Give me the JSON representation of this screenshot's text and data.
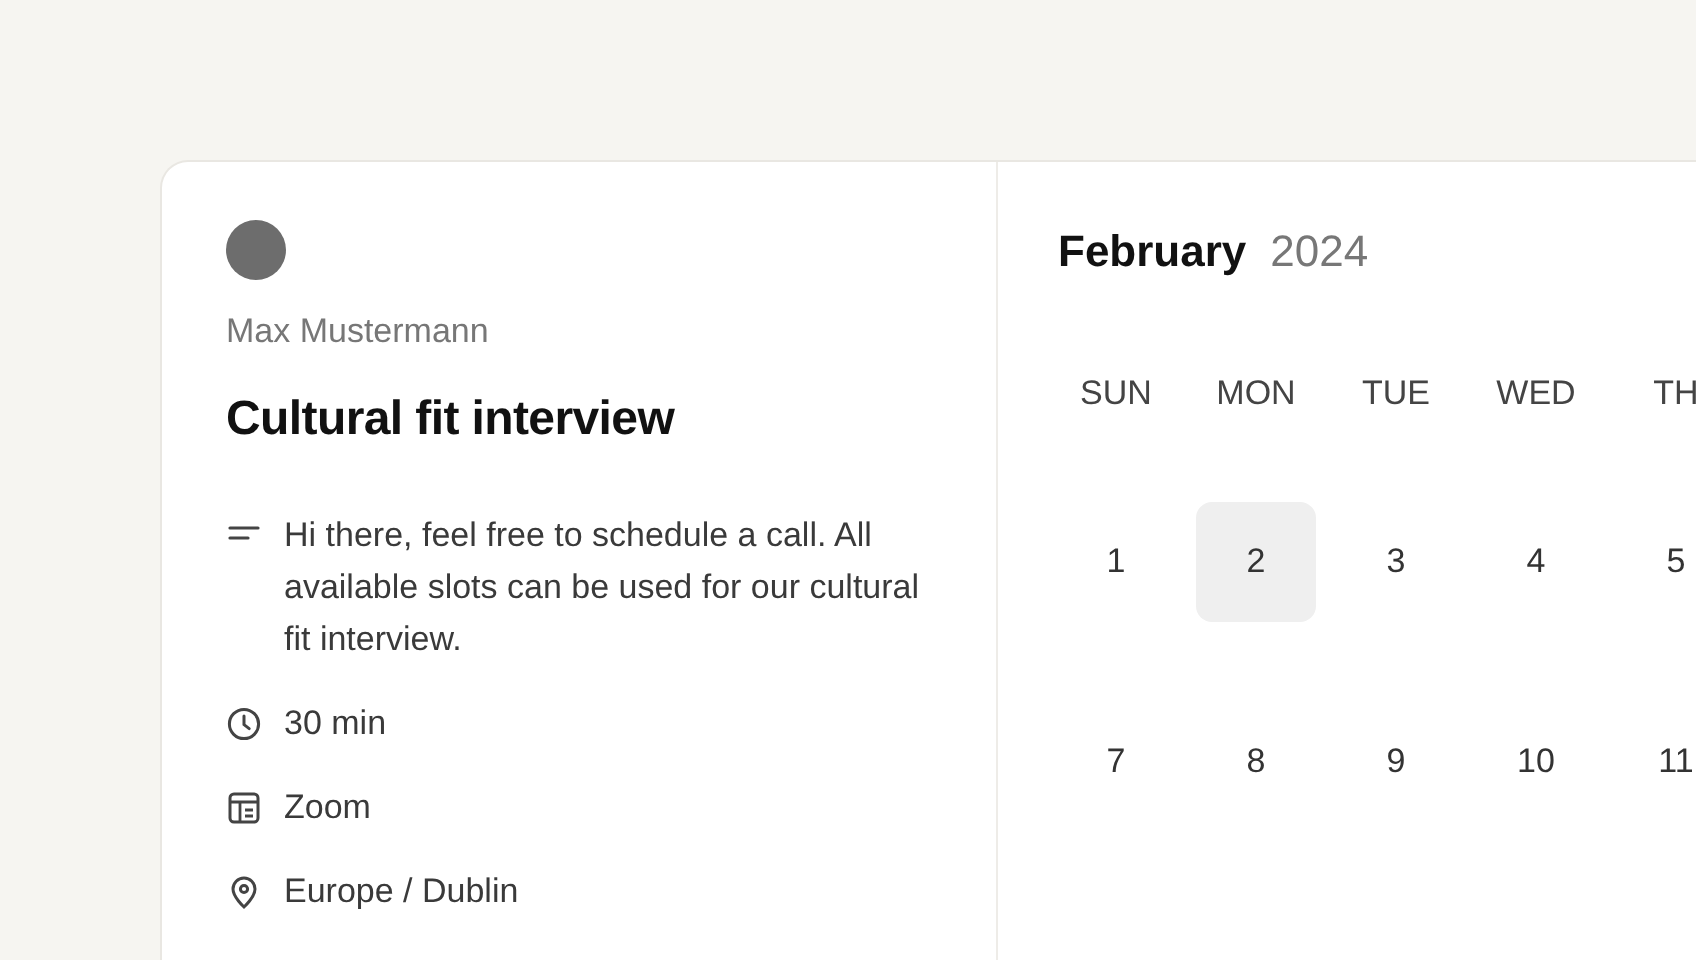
{
  "host": {
    "name": "Max Mustermann"
  },
  "event": {
    "title": "Cultural fit interview",
    "details": [
      {
        "kind": "description",
        "text": "Hi there, feel free to schedule a call. All available slots can be used for our cultural fit interview."
      },
      {
        "kind": "duration",
        "text": "30 min"
      },
      {
        "kind": "app",
        "text": "Zoom"
      },
      {
        "kind": "timezone",
        "text": "Europe / Dublin"
      }
    ]
  },
  "calendar": {
    "month": "February",
    "year": "2024",
    "weekdays": [
      "SUN",
      "MON",
      "TUE",
      "WED",
      "TH"
    ],
    "weeks": [
      [
        {
          "day": "1",
          "selected": false
        },
        {
          "day": "2",
          "selected": true
        },
        {
          "day": "3",
          "selected": false
        },
        {
          "day": "4",
          "selected": false
        },
        {
          "day": "5",
          "selected": false
        }
      ],
      [
        {
          "day": "7",
          "selected": false
        },
        {
          "day": "8",
          "selected": false
        },
        {
          "day": "9",
          "selected": false
        },
        {
          "day": "10",
          "selected": false
        },
        {
          "day": "11",
          "selected": false
        }
      ]
    ]
  }
}
